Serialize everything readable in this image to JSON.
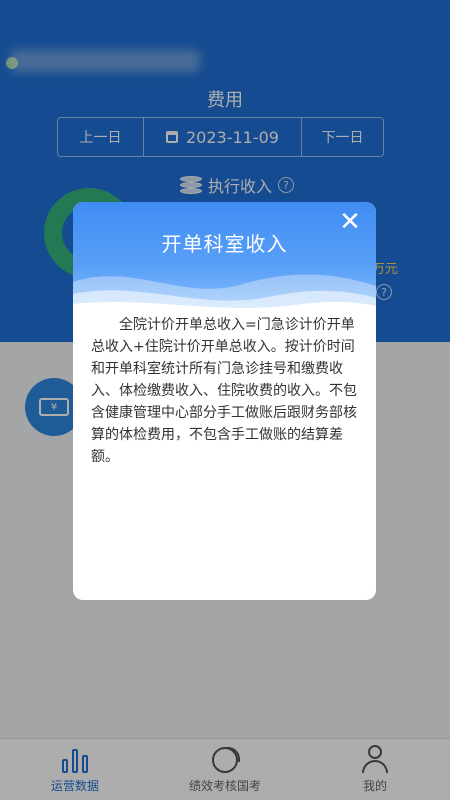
{
  "page": {
    "title": "费用",
    "date_nav": {
      "prev_label": "上一日",
      "date": "2023-11-09",
      "next_label": "下一日"
    },
    "section_label": "执行收入",
    "amount_unit": "万元",
    "help_glyph": "?",
    "ticket_glyph": "¥"
  },
  "modal": {
    "title": "开单科室收入",
    "close_glyph": "✕",
    "body": "全院计价开单总收入=门急诊计价开单总收入+住院计价开单总收入。按计价时间和开单科室统计所有门急诊挂号和缴费收入、体检缴费收入、住院收费的收入。不包含健康管理中心部分手工做账后跟财务部核算的体检费用，不包含手工做账的结算差额。"
  },
  "bottom_nav": {
    "items": [
      {
        "label": "运营数据",
        "icon": "bar-chart-icon",
        "active": true
      },
      {
        "label": "绩效考核国考",
        "icon": "pie-chart-icon",
        "active": false
      },
      {
        "label": "我的",
        "icon": "person-icon",
        "active": false
      }
    ]
  },
  "colors": {
    "header": "#1f6fd4",
    "active_nav": "#1f6fd4",
    "modal_header": "#3f8cf3"
  }
}
